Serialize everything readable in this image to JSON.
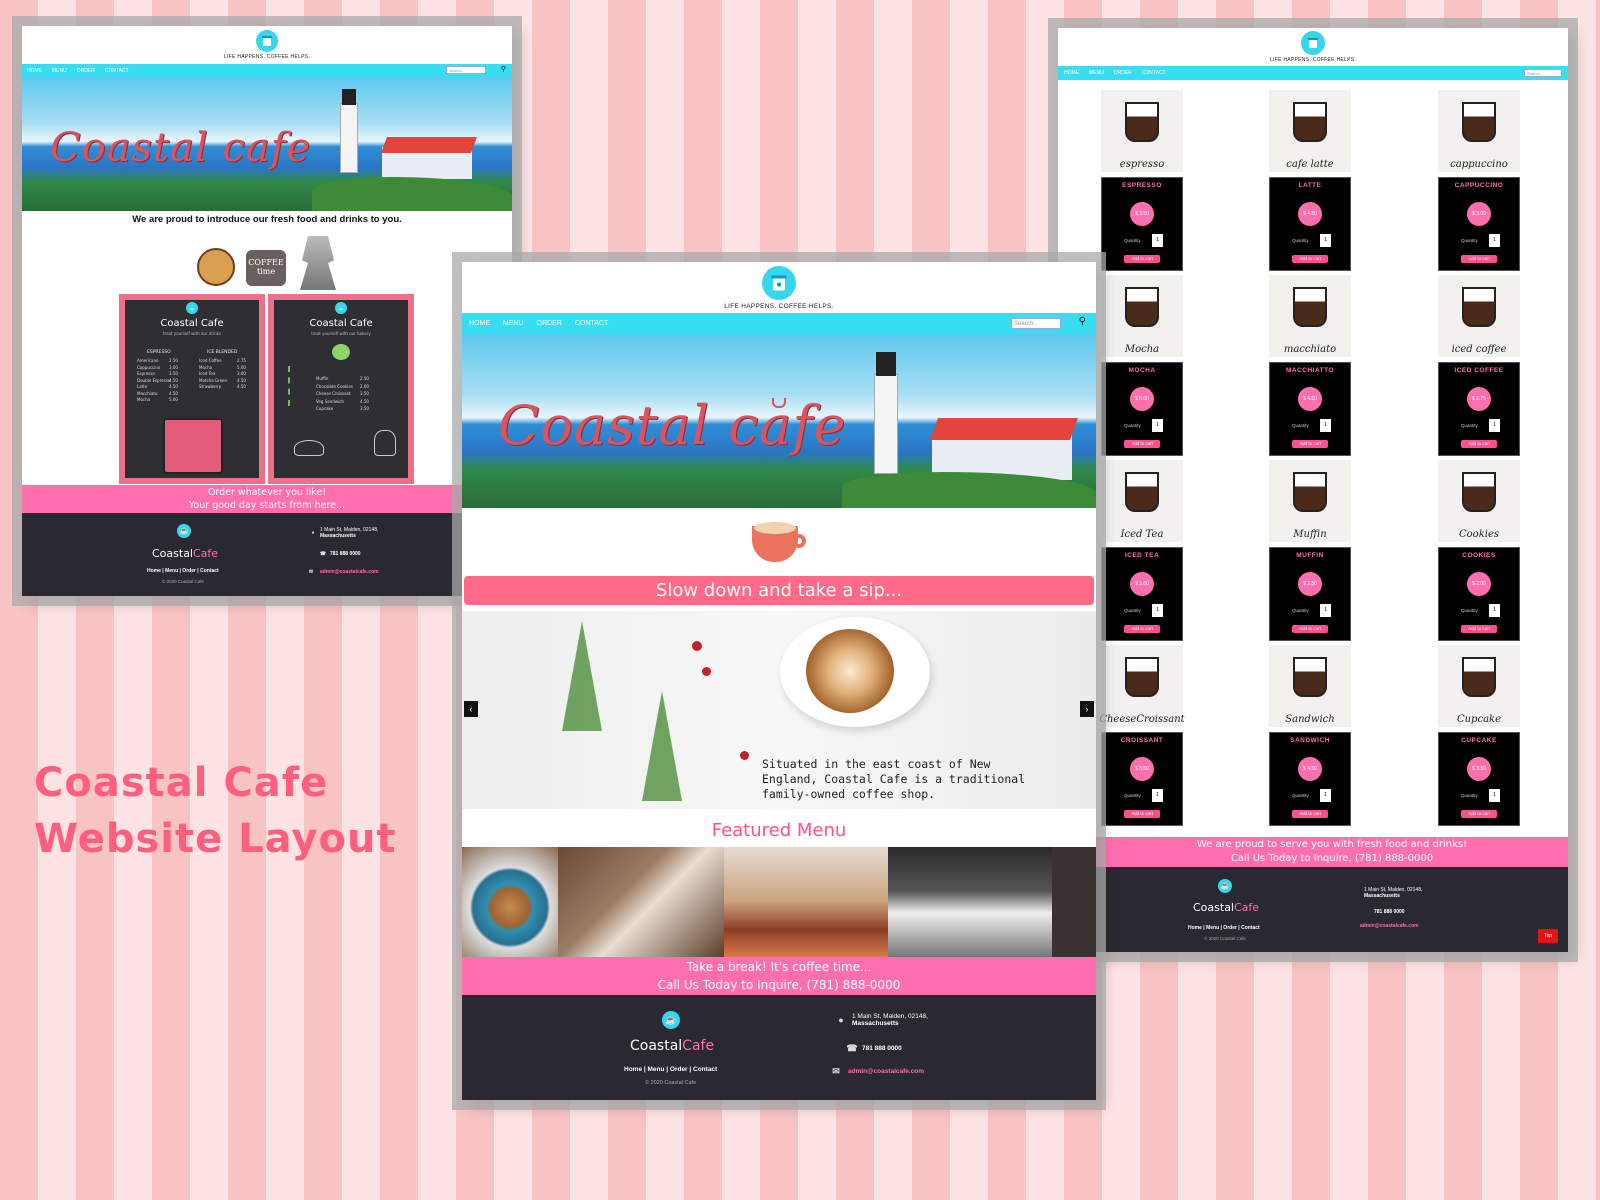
{
  "big_title": {
    "line1": "Coastal Cafe",
    "line2": "Website Layout"
  },
  "site": {
    "tagline": "LIFE HAPPENS. COFFEE HELPS.",
    "nav": [
      "HOME",
      "MENU",
      "ORDER",
      "CONTACT"
    ],
    "search_placeholder": "Search..",
    "hero_brand": "Coastal cafe",
    "footer": {
      "brand_a": "Coastal",
      "brand_b": "Cafe",
      "links": "Home | Menu | Order | Contact",
      "copyright": "© 2020 Coastal Cafe",
      "address1": "1 Main St, Malden, 02148,",
      "address2": "Massachusetts",
      "phone": "781 888 0000",
      "email": "admin@coastalcafe.com"
    }
  },
  "menu_page": {
    "intro": "We are proud to introduce our fresh food and drinks to you.",
    "coffee_sign": "COFFEE time",
    "board1": {
      "title": "Coastal Cafe",
      "sub": "treat yourself with our drinks",
      "col1": "ESPRESSO",
      "col2": "ICE BLENDED",
      "rows": [
        [
          "Americano",
          "2.50",
          "Iced Coffee",
          "2.75"
        ],
        [
          "Cappuccino",
          "3.00",
          "Mocha",
          "5.00"
        ],
        [
          "Espresso",
          "3.50",
          "Iced Tea",
          "3.00"
        ],
        [
          "Double Espresso",
          "4.50",
          "Matcha Green",
          "4.50"
        ],
        [
          "Latte",
          "4.50",
          "Strawberry",
          "4.50"
        ],
        [
          "Macchiato",
          "4.50",
          "",
          ""
        ],
        [
          "Mocha",
          "5.00",
          "",
          ""
        ]
      ]
    },
    "board2": {
      "title": "Coastal Cafe",
      "sub": "treat yourself with our bakery",
      "rows": [
        [
          "Muffin",
          "2.50"
        ],
        [
          "Chocolate Cookies",
          "2.00"
        ],
        [
          "Cheese Croissant",
          "3.50"
        ],
        [
          "Veg Sandwich",
          "4.50"
        ],
        [
          "Cupcake",
          "3.50"
        ]
      ]
    },
    "banner1": "Order whatever you like!",
    "banner2": "Your good day starts from here..."
  },
  "home_page": {
    "sip": "Slow down and take a sip...",
    "slide_text": "Situated in the east coast of New England, Coastal Cafe is a traditional family-owned coffee shop.",
    "featured": "Featured Menu",
    "banner1": "Take a break! It's coffee time...",
    "banner2": "Call Us Today to Inquire, (781) 888-0000"
  },
  "order_page": {
    "quantity_label": "Quantity",
    "add_label": "Add to cart",
    "qty_value": "1",
    "products": [
      {
        "name": "ESPRESSO",
        "price": "$ 3.50",
        "caption": "espresso"
      },
      {
        "name": "LATTE",
        "price": "$ 4.50",
        "caption": "cafe latte"
      },
      {
        "name": "CAPPUCCINO",
        "price": "$ 3.00",
        "caption": "cappuccino"
      },
      {
        "name": "MOCHA",
        "price": "$ 5.00",
        "caption": "Mocha"
      },
      {
        "name": "MACCHIATTO",
        "price": "$ 4.50",
        "caption": "macchiato"
      },
      {
        "name": "ICED COFFEE",
        "price": "$ 2.75",
        "caption": "iced coffee"
      },
      {
        "name": "ICED TEA",
        "price": "$ 3.00",
        "caption": "Iced Tea"
      },
      {
        "name": "MUFFIN",
        "price": "$ 2.50",
        "caption": "Muffin"
      },
      {
        "name": "COOKIES",
        "price": "$ 2.00",
        "caption": "Cookies"
      },
      {
        "name": "CROISSANT",
        "price": "$ 3.50",
        "caption": "CheeseCroissant"
      },
      {
        "name": "SANDWICH",
        "price": "$ 4.50",
        "caption": "Sandwich"
      },
      {
        "name": "CUPCAKE",
        "price": "$ 3.50",
        "caption": "Cupcake"
      }
    ],
    "banner1": "We are proud to serve you with fresh food and drinks!",
    "banner2": "Call Us Today to Inquire, (781) 888-0000",
    "top_button": "Top"
  },
  "colors": {
    "nav": "#37ddf0",
    "pink": "#ff6fae",
    "footer": "#2a2830",
    "title": "#ff5f7e"
  }
}
